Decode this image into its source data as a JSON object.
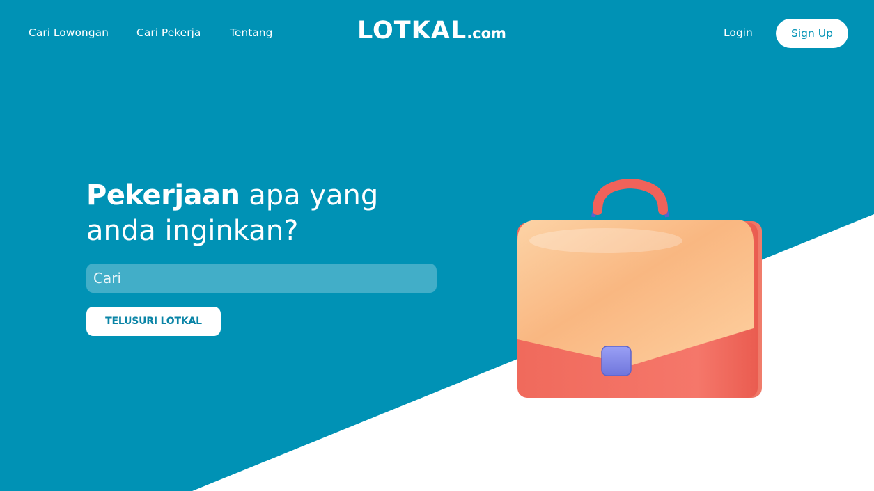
{
  "nav": {
    "links": [
      "Cari Lowongan",
      "Cari Pekerja",
      "Tentang"
    ],
    "login_label": "Login",
    "signup_label": "Sign Up"
  },
  "logo": {
    "main": "LOTKAL",
    "suffix": ".com"
  },
  "hero": {
    "headline_bold": "Pekerjaan",
    "headline_rest_line1": "apa yang",
    "headline_line2": "anda inginkan?",
    "search_placeholder": "Cari",
    "search_value": "",
    "cta_label": "TELUSURI LOTKAL",
    "illustration": "briefcase-icon"
  },
  "colors": {
    "primary": "#0092b5",
    "white": "#ffffff",
    "briefcase_body": "#f26b5b",
    "briefcase_flap": "#fbc08a",
    "briefcase_clasp": "#7f86ea"
  }
}
